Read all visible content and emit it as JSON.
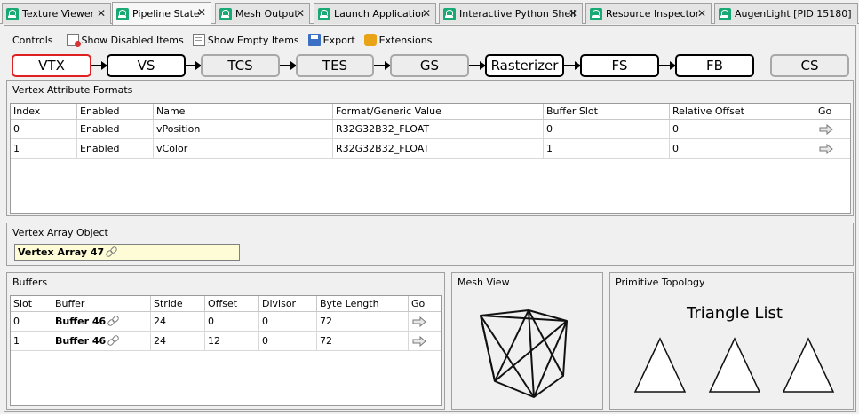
{
  "tabs": [
    {
      "label": "Texture Viewer",
      "active": false
    },
    {
      "label": "Pipeline State",
      "active": true
    },
    {
      "label": "Mesh Output",
      "active": false
    },
    {
      "label": "Launch Application",
      "active": false
    },
    {
      "label": "Interactive Python Shell",
      "active": false
    },
    {
      "label": "Resource Inspector",
      "active": false
    },
    {
      "label": "AugenLight [PID 15180]",
      "active": false
    }
  ],
  "toolbar": {
    "controls_label": "Controls",
    "show_disabled_label": "Show Disabled Items",
    "show_empty_label": "Show Empty Items",
    "export_label": "Export",
    "extensions_label": "Extensions"
  },
  "stages": [
    {
      "label": "VTX",
      "state": "selected"
    },
    {
      "label": "VS",
      "state": "active"
    },
    {
      "label": "TCS",
      "state": "disabled"
    },
    {
      "label": "TES",
      "state": "disabled"
    },
    {
      "label": "GS",
      "state": "disabled"
    },
    {
      "label": "Rasterizer",
      "state": "active"
    },
    {
      "label": "FS",
      "state": "active"
    },
    {
      "label": "FB",
      "state": "active"
    },
    {
      "label": "CS",
      "state": "disabled"
    }
  ],
  "vertex_attributes": {
    "title": "Vertex Attribute Formats",
    "columns": [
      "Index",
      "Enabled",
      "Name",
      "Format/Generic Value",
      "Buffer Slot",
      "Relative Offset",
      "Go"
    ],
    "rows": [
      [
        "0",
        "Enabled",
        "vPosition",
        "R32G32B32_FLOAT",
        "0",
        "0"
      ],
      [
        "1",
        "Enabled",
        "vColor",
        "R32G32B32_FLOAT",
        "1",
        "0"
      ]
    ]
  },
  "vao": {
    "title": "Vertex Array Object",
    "value": "Vertex Array 47"
  },
  "buffers": {
    "title": "Buffers",
    "columns": [
      "Slot",
      "Buffer",
      "Stride",
      "Offset",
      "Divisor",
      "Byte Length",
      "Go"
    ],
    "rows": [
      [
        "0",
        "Buffer 46",
        "24",
        "0",
        "0",
        "72"
      ],
      [
        "1",
        "Buffer 46",
        "24",
        "12",
        "0",
        "72"
      ]
    ]
  },
  "mesh_view": {
    "title": "Mesh View"
  },
  "topology": {
    "title": "Primitive Topology",
    "value": "Triangle List"
  },
  "colors": {
    "accent_selected": "#e02020",
    "vao_bg": "#fefbd7",
    "tab_icon": "#19a974"
  }
}
